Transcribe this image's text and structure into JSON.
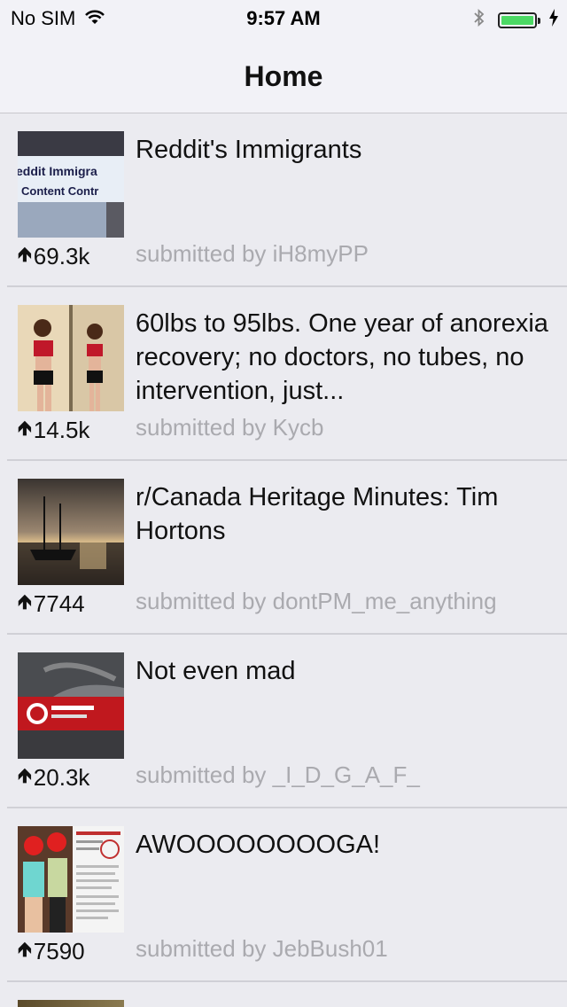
{
  "status_bar": {
    "carrier": "No SIM",
    "time": "9:57 AM"
  },
  "nav": {
    "title": "Home"
  },
  "posts": [
    {
      "title": "Reddit's Immigrants",
      "score": "69.3k",
      "submitted": "submitted by iH8myPP",
      "thumb_text_1": "eddit Immigra",
      "thumb_text_2": "Content Contr"
    },
    {
      "title": "60lbs to 95lbs. One year of anorexia recovery; no doctors, no tubes, no intervention, just...",
      "score": "14.5k",
      "submitted": "submitted by Kycb"
    },
    {
      "title": "r/Canada Heritage Minutes: Tim Hortons",
      "score": "7744",
      "submitted": "submitted by dontPM_me_anything"
    },
    {
      "title": "Not even mad",
      "score": "20.3k",
      "submitted": "submitted by _I_D_G_A_F_"
    },
    {
      "title": "AWOOOOOOOOGA!",
      "score": "7590",
      "submitted": "submitted by JebBush01"
    }
  ],
  "colors": {
    "background": "#ebebf0",
    "bar_background": "#f2f2f7",
    "battery": "#4cd964",
    "muted_text": "#aaaaaf"
  }
}
